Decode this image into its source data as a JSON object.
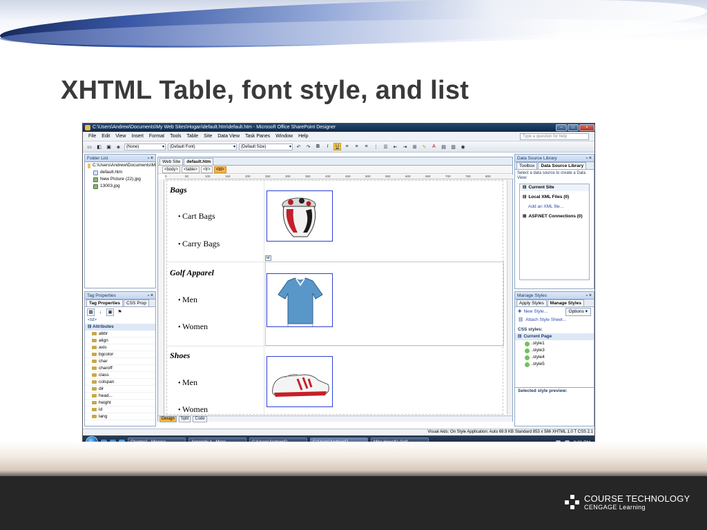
{
  "slide": {
    "title": "XHTML Table, font style, and list",
    "logo_line1": "COURSE TECHNOLOGY",
    "logo_line2": "CENGAGE Learning"
  },
  "window": {
    "title": "C:\\Users\\Andrew\\Documents\\My Web Sites\\Hogan\\default.htm\\default.htm - Microsoft Office SharePoint Designer",
    "controls": [
      "–",
      "□",
      "×"
    ]
  },
  "menu": [
    "File",
    "Edit",
    "View",
    "Insert",
    "Format",
    "Tools",
    "Table",
    "Site",
    "Data View",
    "Task Panes",
    "Window",
    "Help"
  ],
  "help_placeholder": "Type a question for help",
  "toolbar": {
    "style_value": "(None)",
    "font_value": "(Default Font)",
    "size_value": "(Default Size)",
    "bold": "B",
    "italic": "I",
    "underline": "U"
  },
  "folder_list": {
    "title": "Folder List",
    "items": [
      "C:\\Users\\Andrew\\Documents\\M",
      "default.htm",
      "New Picture (22).jpg",
      "13003.jpg"
    ]
  },
  "tag_properties": {
    "title": "Tag Properties",
    "tabs": [
      "Tag Properties",
      "CSS Prop"
    ],
    "tag": "<td>",
    "section": "Attributes",
    "attributes": [
      "abbr",
      "align",
      "axis",
      "bgcolor",
      "char",
      "charoff",
      "class",
      "colspan",
      "dir",
      "head...",
      "height",
      "id",
      "lang"
    ]
  },
  "editor": {
    "tabs": [
      "Web Site",
      "default.htm"
    ],
    "breadcrumbs": [
      "<body>",
      "<table>",
      "<tr>",
      "<td>"
    ],
    "ruler": [
      "0",
      "50",
      "100",
      "150",
      "200",
      "250",
      "300",
      "350",
      "400",
      "450",
      "500",
      "550",
      "600",
      "650",
      "700",
      "750",
      "800"
    ],
    "td_label": "td",
    "view_tabs": [
      "Design",
      "Split",
      "Code"
    ],
    "categories": [
      {
        "name": "Bags",
        "items": [
          "Cart Bags",
          "Carry Bags"
        ]
      },
      {
        "name": "Golf Apparel",
        "items": [
          "Men",
          "Women"
        ]
      },
      {
        "name": "Shoes",
        "items": [
          "Men",
          "Women"
        ]
      }
    ]
  },
  "data_source": {
    "title": "Data Source Library",
    "tabs": [
      "Toolbox",
      "Data Source Library"
    ],
    "hint": "Select a data source to create a Data View:",
    "current_site": "Current Site",
    "local_xml": "Local XML Files (0)",
    "add_xml": "Add an XML file...",
    "aspnet": "ASP.NET Connections (0)"
  },
  "manage_styles": {
    "title": "Manage Styles",
    "tabs": [
      "Apply Styles",
      "Manage Styles"
    ],
    "new_style": "New Style...",
    "options": "Options",
    "attach": "Attach Style Sheet...",
    "css_styles": "CSS styles:",
    "current_page": "Current Page",
    "styles": [
      ".style1",
      ".style3",
      ".style4",
      ".style5"
    ],
    "preview": "Selected style preview:"
  },
  "status": "Visual Aids: On   Style Application: Auto   69.9 KB   Standard   853 x 586   XHTML 1.0 T   CSS 2.1",
  "taskbar": {
    "tasks": [
      "Chapter1 - Microso...",
      "Appendix A - Micro...",
      "C:\\Users\\Andrew\\D...",
      "C:\\Users\\Andrew\\D...",
      "Mike Howell's Golf ..."
    ],
    "time": "9:36 PM"
  }
}
